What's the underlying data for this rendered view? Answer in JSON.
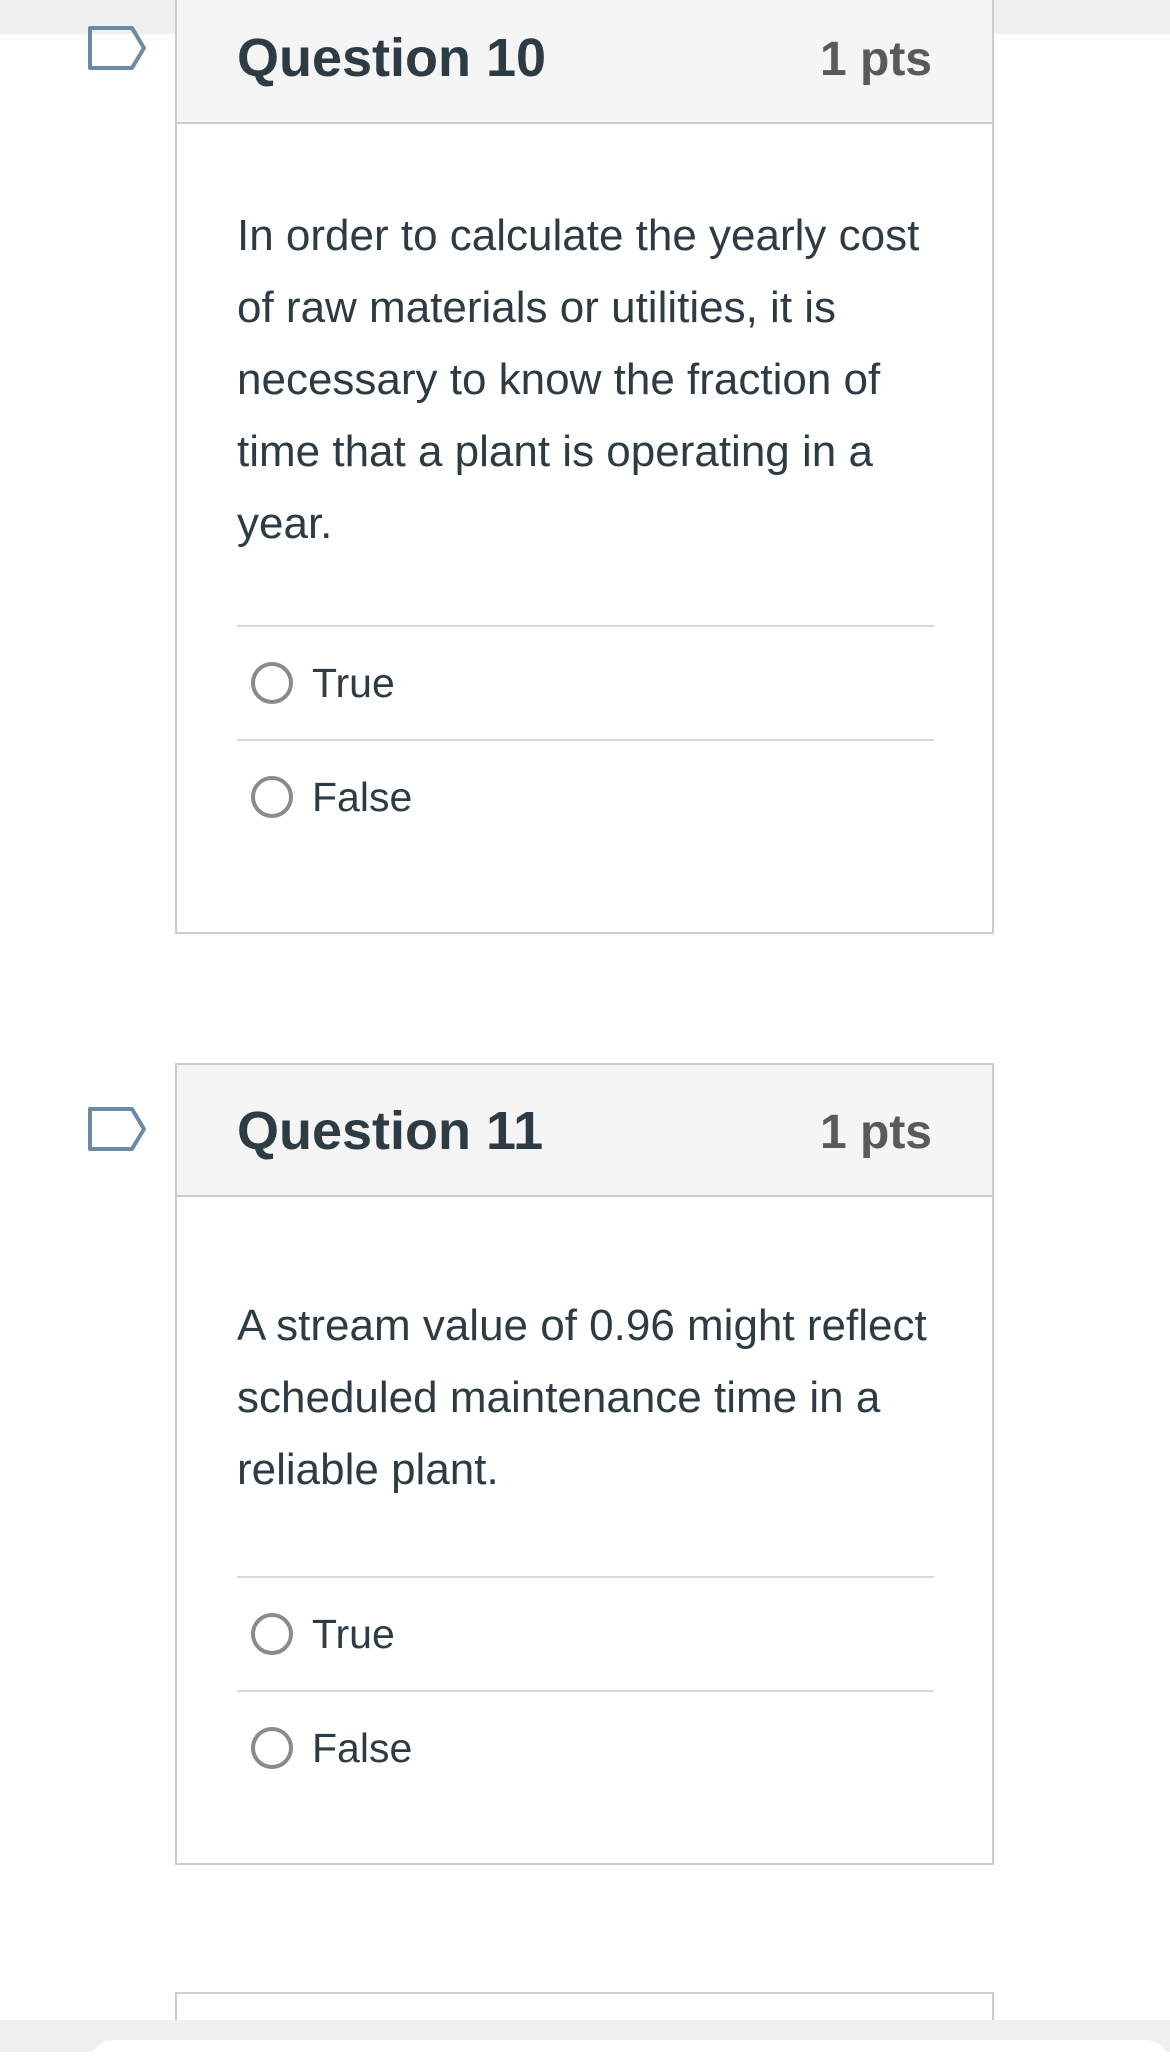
{
  "questions": [
    {
      "title": "Question 10",
      "points": "1 pts",
      "text": "In order to calculate the yearly cost of raw materials or utilities, it is necessary to know the fraction of time that a plant is operating in a year.",
      "answers": [
        "True",
        "False"
      ]
    },
    {
      "title": "Question 11",
      "points": "1 pts",
      "text": "A stream value of 0.96 might reflect scheduled maintenance time in a reliable plant.",
      "answers": [
        "True",
        "False"
      ]
    }
  ],
  "icons": {
    "flag": "flag-outline-icon",
    "radio": "radio-unselected-icon"
  },
  "colors": {
    "text": "#2d3b45",
    "points": "#5a5a5a",
    "border": "#c7cdd1",
    "header_bg": "#f5f5f5",
    "flag": "#6b8aa3",
    "radio": "#8b8b8b"
  }
}
